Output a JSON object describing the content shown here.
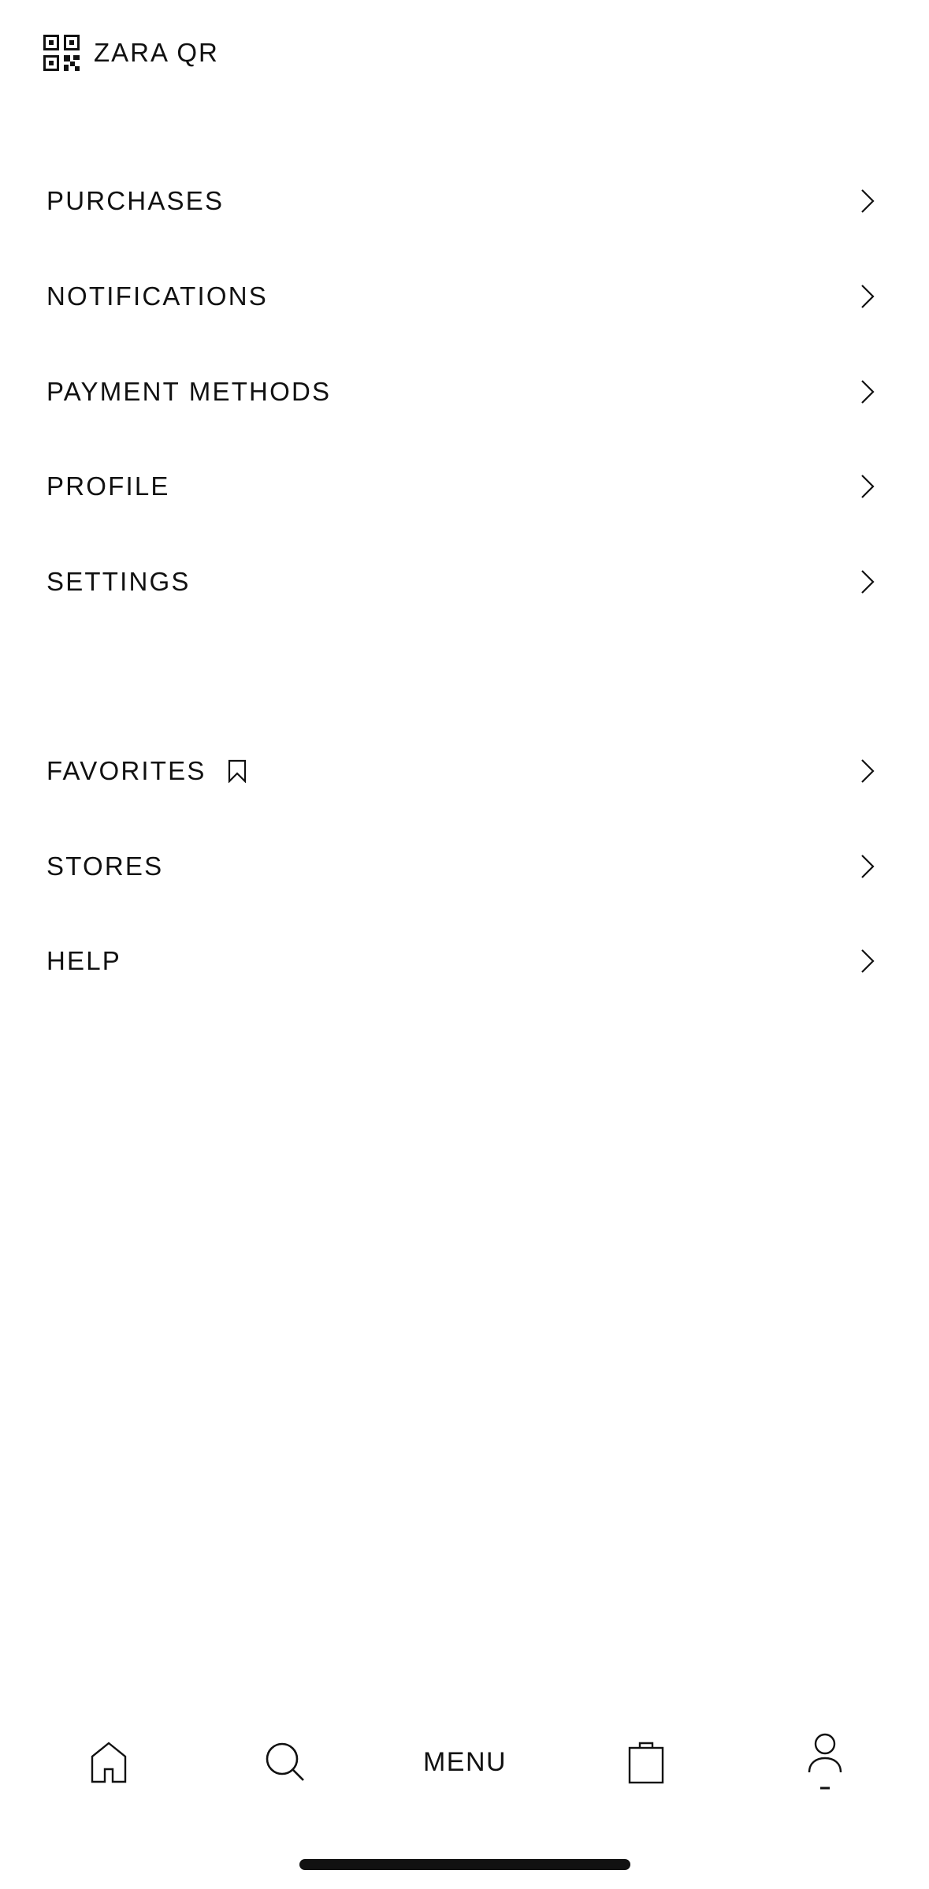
{
  "header": {
    "qr_label": "ZARA QR",
    "qr_icon": "qr-code-icon"
  },
  "menu_primary": [
    {
      "label": "PURCHASES"
    },
    {
      "label": "NOTIFICATIONS"
    },
    {
      "label": "PAYMENT METHODS"
    },
    {
      "label": "PROFILE"
    },
    {
      "label": "SETTINGS"
    }
  ],
  "menu_secondary": [
    {
      "label": "FAVORITES",
      "icon": "bookmark-icon"
    },
    {
      "label": "STORES"
    },
    {
      "label": "HELP"
    }
  ],
  "tab_bar": {
    "home_icon": "home-icon",
    "search_icon": "search-icon",
    "menu_label": "MENU",
    "bag_icon": "shopping-bag-icon",
    "account_icon": "account-icon",
    "active_tab": "account"
  },
  "colors": {
    "background": "#ffffff",
    "text": "#111111"
  }
}
